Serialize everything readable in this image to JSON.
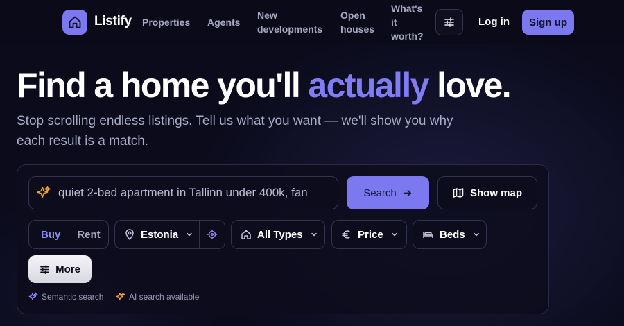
{
  "colors": {
    "accent": "#7b78f0",
    "accent_text": "#7f7cf6",
    "background": "#0b0b1c",
    "sparkle_orange": "#f5a524"
  },
  "nav": {
    "brand": "Listify",
    "links": [
      {
        "line1": "Properties",
        "line2": "",
        "line3": ""
      },
      {
        "line1": "Agents",
        "line2": "",
        "line3": ""
      },
      {
        "line1": "New",
        "line2": "developments",
        "line3": ""
      },
      {
        "line1": "Open",
        "line2": "houses",
        "line3": ""
      },
      {
        "line1": "What's",
        "line2": "it",
        "line3": "worth?"
      }
    ],
    "login": "Log in",
    "signup": "Sign up"
  },
  "hero": {
    "title_before": "Find a home you'll ",
    "title_accent": "actually",
    "title_after": " love.",
    "subtitle": "Stop scrolling endless listings. Tell us what you want — we'll show you why each result is a match."
  },
  "search": {
    "value": "quiet 2-bed apartment in Tallinn under 400k, fan",
    "button_label": "Search",
    "map_label": "Show map"
  },
  "filters": {
    "buy": "Buy",
    "rent": "Rent",
    "location": "Estonia",
    "types": "All Types",
    "price": "Price",
    "beds": "Beds",
    "more": "More"
  },
  "notes": {
    "semantic": "Semantic search",
    "ai": "AI search available"
  }
}
